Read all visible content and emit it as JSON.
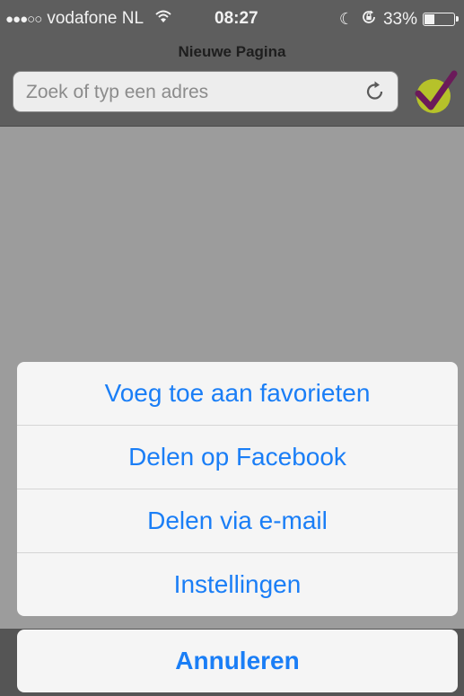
{
  "status_bar": {
    "signal_dots": "●●●○○",
    "carrier": "vodafone NL",
    "time": "08:27",
    "battery": "33%",
    "battery_level": 0.33
  },
  "page": {
    "title": "Nieuwe Pagina"
  },
  "address_bar": {
    "placeholder": "Zoek of typ een adres",
    "value": ""
  },
  "action_sheet": {
    "items": [
      {
        "label": "Voeg toe aan favorieten"
      },
      {
        "label": "Delen op Facebook"
      },
      {
        "label": "Delen via e-mail"
      },
      {
        "label": "Instellingen"
      }
    ],
    "cancel_label": "Annuleren"
  },
  "colors": {
    "accent": "#1a7ef6",
    "logo_circle": "#b6c22a",
    "logo_check": "#6b1a5a"
  },
  "icons": [
    "wifi-icon",
    "moon-icon",
    "rotation-lock-icon",
    "battery-icon",
    "reload-icon",
    "checkmark-logo-icon",
    "back-icon",
    "forward-icon",
    "share-icon",
    "bookmarks-icon",
    "plus-icon"
  ]
}
